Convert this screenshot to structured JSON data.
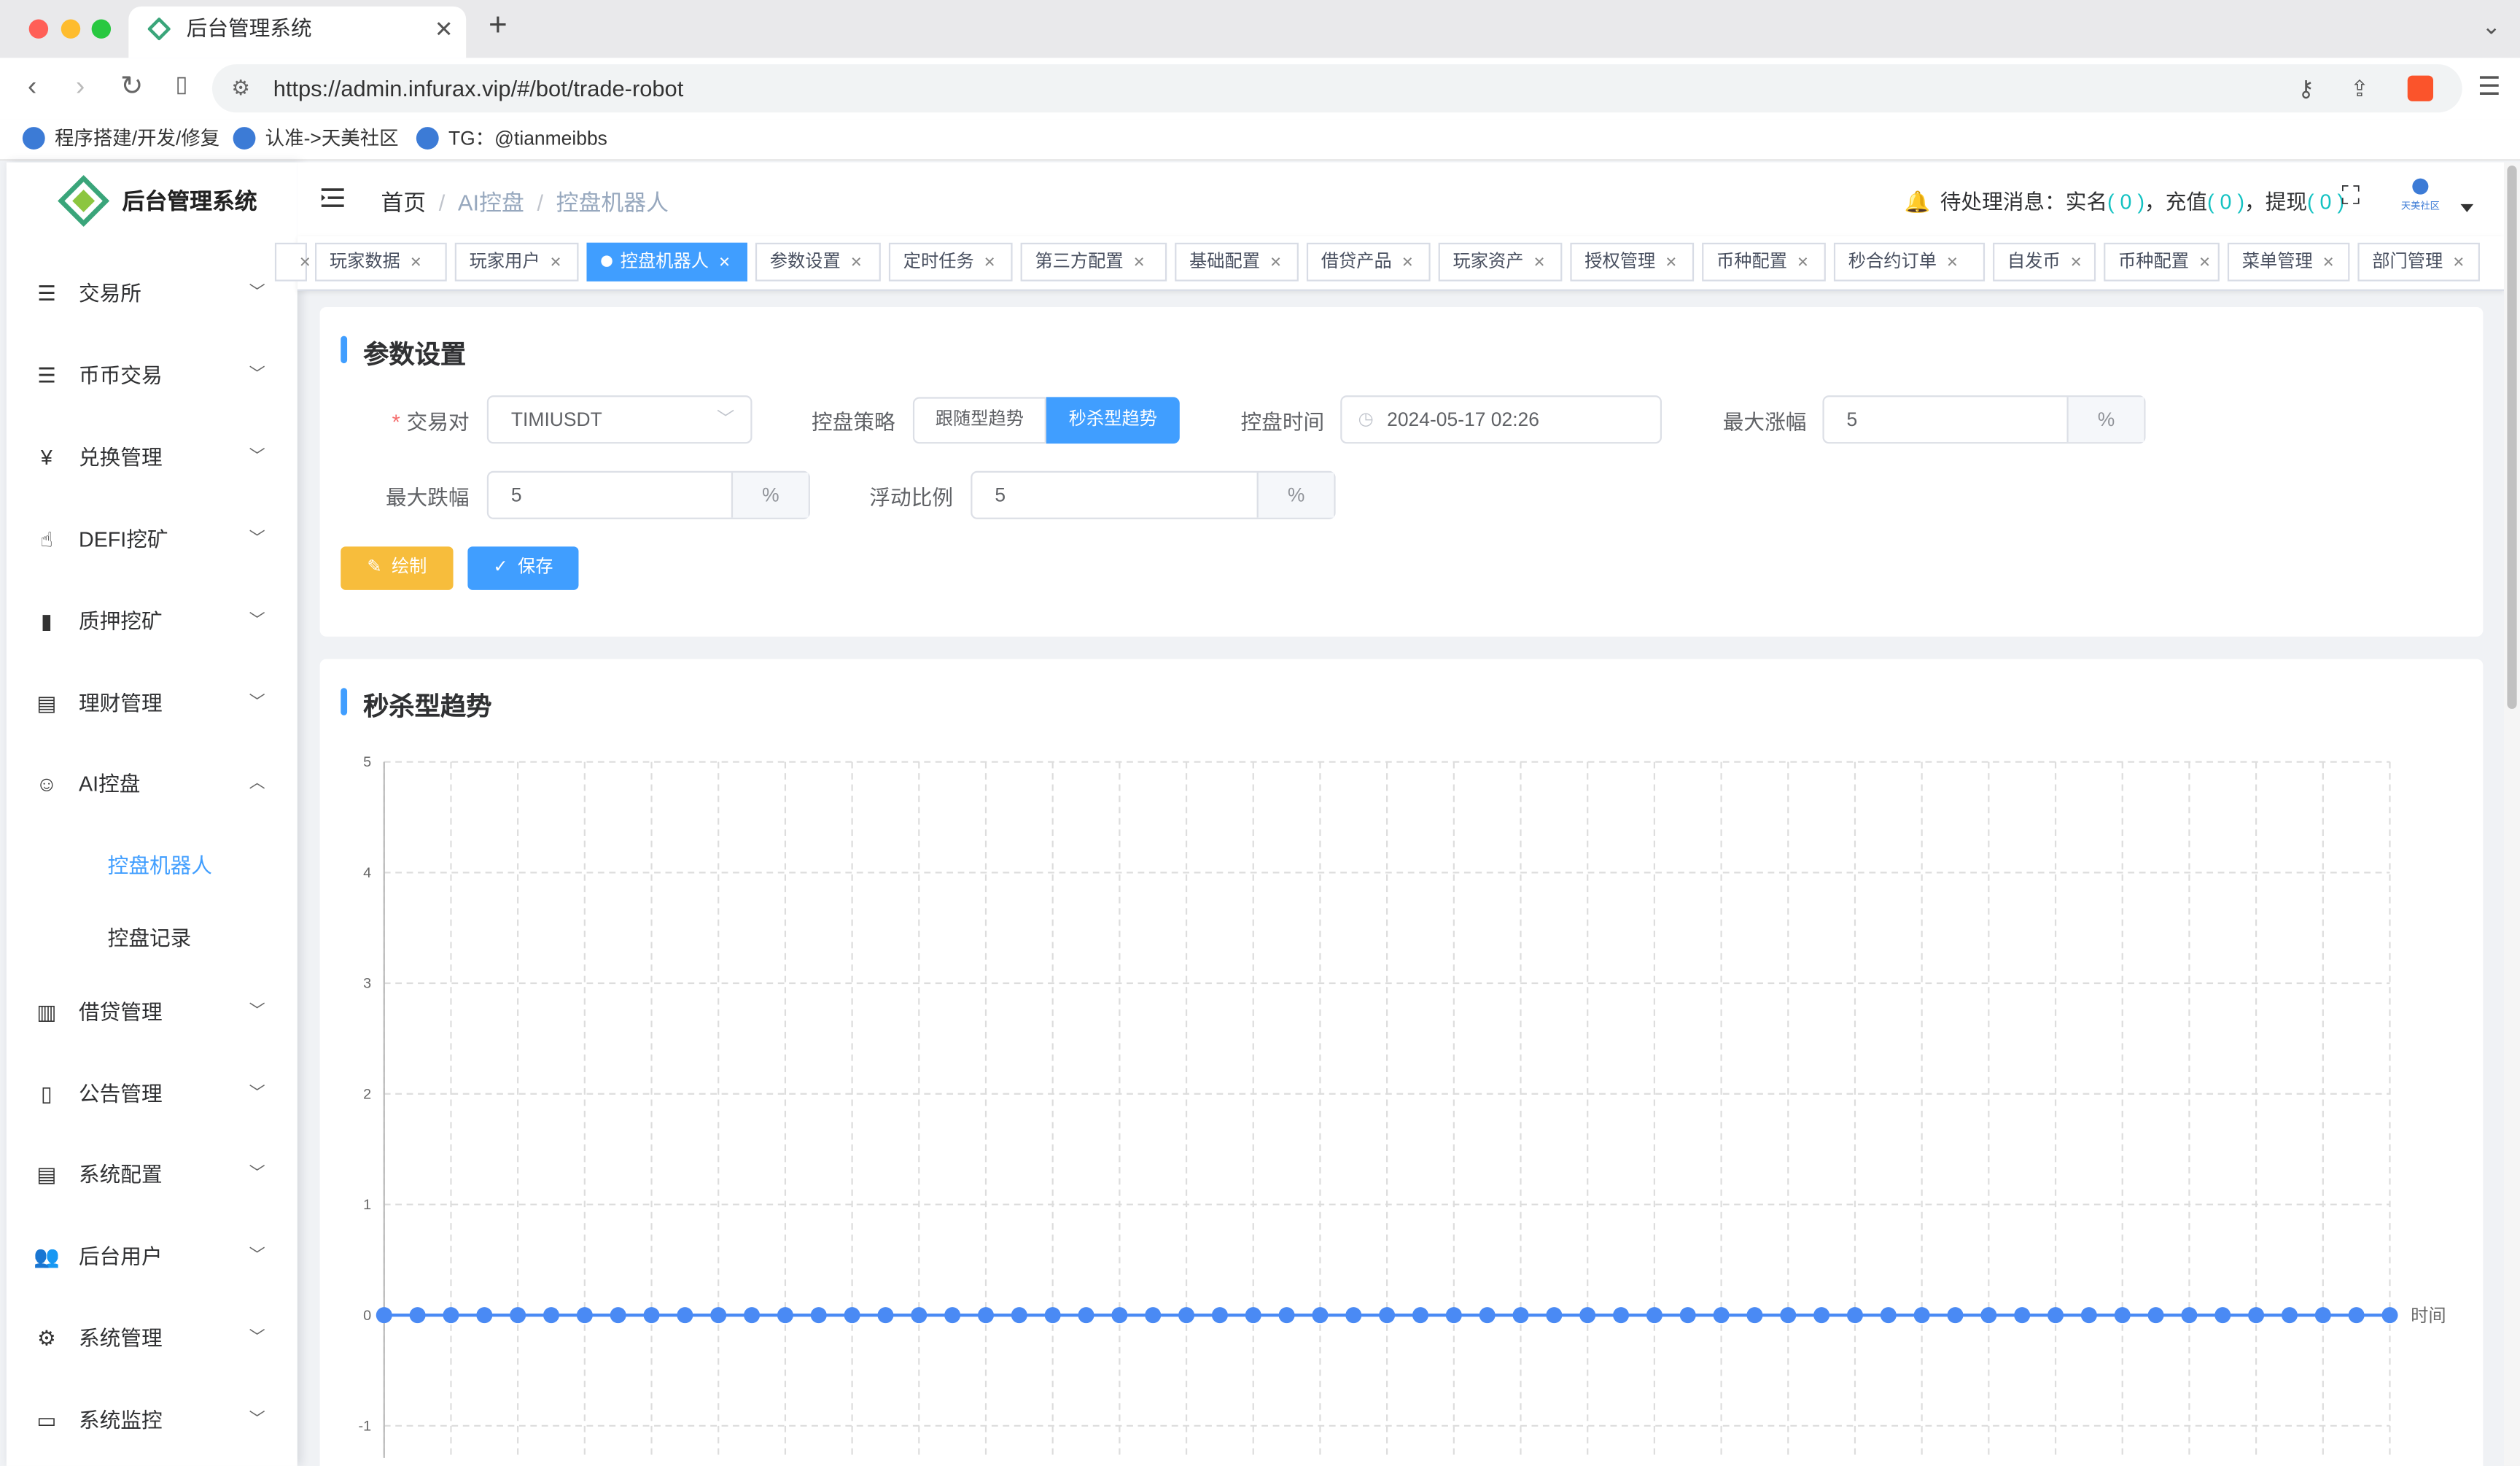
{
  "browser": {
    "tab_title": "后台管理系统",
    "url": "https://admin.infurax.vip/#/bot/trade-robot",
    "bookmarks": [
      "程序搭建/开发/修复",
      "认准->天美社区",
      "TG：@tianmeibbs"
    ]
  },
  "app": {
    "title": "后台管理系统",
    "avatar_text": "天美社区"
  },
  "sidebar": {
    "items": [
      {
        "label": "交易所",
        "icon": "list-icon"
      },
      {
        "label": "币币交易",
        "icon": "list-icon"
      },
      {
        "label": "兑换管理",
        "icon": "yen-icon"
      },
      {
        "label": "DEFI挖矿",
        "icon": "touch-icon"
      },
      {
        "label": "质押挖矿",
        "icon": "bar-chart-icon"
      },
      {
        "label": "理财管理",
        "icon": "document-icon"
      },
      {
        "label": "AI控盘",
        "icon": "robot-icon",
        "expanded": true
      },
      {
        "label": "借贷管理",
        "icon": "book-icon"
      },
      {
        "label": "公告管理",
        "icon": "open-book-icon"
      },
      {
        "label": "系统配置",
        "icon": "document-icon"
      },
      {
        "label": "后台用户",
        "icon": "users-icon"
      },
      {
        "label": "系统管理",
        "icon": "gear-icon"
      },
      {
        "label": "系统监控",
        "icon": "monitor-icon"
      }
    ],
    "sub_items": [
      {
        "label": "控盘机器人",
        "active": true
      },
      {
        "label": "控盘记录",
        "active": false
      }
    ]
  },
  "header": {
    "breadcrumb": [
      "首页",
      "AI控盘",
      "控盘机器人"
    ],
    "notice_label": "待处理消息：",
    "notices": [
      {
        "label": "实名",
        "count": "( 0 )"
      },
      {
        "label": "充值",
        "count": "( 0 )"
      },
      {
        "label": "提现",
        "count": "( 0 )"
      }
    ]
  },
  "tags": [
    {
      "label": "",
      "active": false
    },
    {
      "label": "玩家数据",
      "active": false
    },
    {
      "label": "玩家用户",
      "active": false
    },
    {
      "label": "控盘机器人",
      "active": true
    },
    {
      "label": "参数设置",
      "active": false
    },
    {
      "label": "定时任务",
      "active": false
    },
    {
      "label": "第三方配置",
      "active": false
    },
    {
      "label": "基础配置",
      "active": false
    },
    {
      "label": "借贷产品",
      "active": false
    },
    {
      "label": "玩家资产",
      "active": false
    },
    {
      "label": "授权管理",
      "active": false
    },
    {
      "label": "币种配置",
      "active": false
    },
    {
      "label": "秒合约订单",
      "active": false
    },
    {
      "label": "自发币",
      "active": false
    },
    {
      "label": "币种配置",
      "active": false
    },
    {
      "label": "菜单管理",
      "active": false
    },
    {
      "label": "部门管理",
      "active": false
    }
  ],
  "settings": {
    "title": "参数设置",
    "pair_label": "交易对",
    "pair_value": "TIMIUSDT",
    "strategy_label": "控盘策略",
    "strategy_options": [
      "跟随型趋势",
      "秒杀型趋势"
    ],
    "strategy_selected": "秒杀型趋势",
    "time_label": "控盘时间",
    "time_value": "2024-05-17 02:26",
    "max_rise_label": "最大涨幅",
    "max_rise_value": "5",
    "max_fall_label": "最大跌幅",
    "max_fall_value": "5",
    "float_label": "浮动比例",
    "float_value": "5",
    "percent_unit": "%",
    "draw_button": "绘制",
    "save_button": "保存"
  },
  "chart_panel": {
    "title": "秒杀型趋势"
  },
  "chart_data": {
    "type": "line",
    "title": "秒杀型趋势",
    "xlabel": "时间",
    "ylabel": "",
    "ylim": [
      -1,
      5
    ],
    "y_ticks": [
      "5",
      "4",
      "3",
      "2",
      "1",
      "0",
      "-1"
    ],
    "point_count": 61,
    "values": [
      0,
      0,
      0,
      0,
      0,
      0,
      0,
      0,
      0,
      0,
      0,
      0,
      0,
      0,
      0,
      0,
      0,
      0,
      0,
      0,
      0,
      0,
      0,
      0,
      0,
      0,
      0,
      0,
      0,
      0,
      0,
      0,
      0,
      0,
      0,
      0,
      0,
      0,
      0,
      0,
      0,
      0,
      0,
      0,
      0,
      0,
      0,
      0,
      0,
      0,
      0,
      0,
      0,
      0,
      0,
      0,
      0,
      0,
      0,
      0,
      0
    ],
    "grid": true,
    "color": "#4a8af4"
  }
}
